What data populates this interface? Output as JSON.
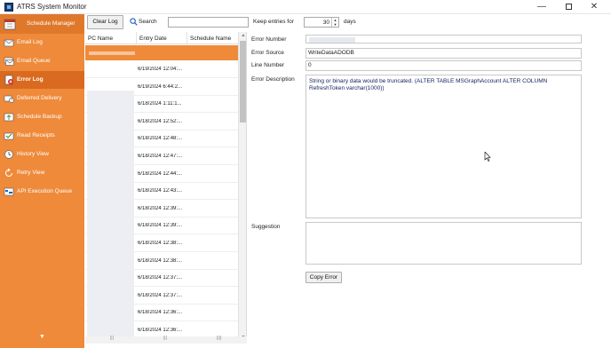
{
  "window": {
    "title": "ATRS System Monitor",
    "minimize": "—",
    "close": "✕"
  },
  "sidebar": {
    "items": [
      {
        "label": "Schedule Manager",
        "icon": "calendar-icon",
        "active": false
      },
      {
        "label": "Email Log",
        "icon": "email-icon",
        "active": false
      },
      {
        "label": "Email Queue",
        "icon": "mail-queue-icon",
        "active": false
      },
      {
        "label": "Error Log",
        "icon": "error-icon",
        "active": true
      },
      {
        "label": "Deferred Delivery",
        "icon": "deferred-icon",
        "active": false
      },
      {
        "label": "Schedule Backup",
        "icon": "backup-icon",
        "active": false
      },
      {
        "label": "Read Receipts",
        "icon": "receipt-icon",
        "active": false
      },
      {
        "label": "History View",
        "icon": "history-icon",
        "active": false
      },
      {
        "label": "Retry View",
        "icon": "retry-icon",
        "active": false
      },
      {
        "label": "API Execution Queue",
        "icon": "api-icon",
        "active": false
      }
    ],
    "more_arrow": "▼"
  },
  "toolbar": {
    "clear_log": "Clear Log",
    "search_label": "Search",
    "search_value": "",
    "keep_entries_label": "Keep entries for",
    "keep_entries_value": "30",
    "days_label": "days"
  },
  "grid": {
    "columns": [
      "PC Name",
      "Entry Date",
      "Schedule Name"
    ],
    "rows": [
      {
        "entry_date": "6/19/2024 12:04:..."
      },
      {
        "entry_date": "6/19/2024 6:44:2..."
      },
      {
        "entry_date": "6/18/2024 1:11:1..."
      },
      {
        "entry_date": "6/18/2024 12:52:..."
      },
      {
        "entry_date": "6/18/2024 12:48:..."
      },
      {
        "entry_date": "6/18/2024 12:47:..."
      },
      {
        "entry_date": "6/18/2024 12:44:..."
      },
      {
        "entry_date": "6/18/2024 12:43:..."
      },
      {
        "entry_date": "6/18/2024 12:39:..."
      },
      {
        "entry_date": "6/18/2024 12:39:..."
      },
      {
        "entry_date": "6/18/2024 12:38:..."
      },
      {
        "entry_date": "6/18/2024 12:38:..."
      },
      {
        "entry_date": "6/18/2024 12:37:..."
      },
      {
        "entry_date": "6/18/2024 12:37:..."
      },
      {
        "entry_date": "6/18/2024 12:36:..."
      },
      {
        "entry_date": "6/18/2024 12:36:..."
      }
    ]
  },
  "details": {
    "error_number_label": "Error Number",
    "error_source_label": "Error Source",
    "error_source_value": "WriteDataADODB",
    "line_number_label": "Line Number",
    "line_number_value": "0",
    "error_description_label": "Error Description",
    "error_description_value": "String or binary data would be truncated. (ALTER TABLE MSGraphAccount ALTER COLUMN RefreshToken varchar(1000))",
    "suggestion_label": "Suggestion",
    "suggestion_value": "",
    "copy_error": "Copy Error"
  },
  "colors": {
    "sidebar": "#ee8a3a",
    "sidebar_active": "#d96a1f",
    "selected_row": "#ef8a3a"
  }
}
